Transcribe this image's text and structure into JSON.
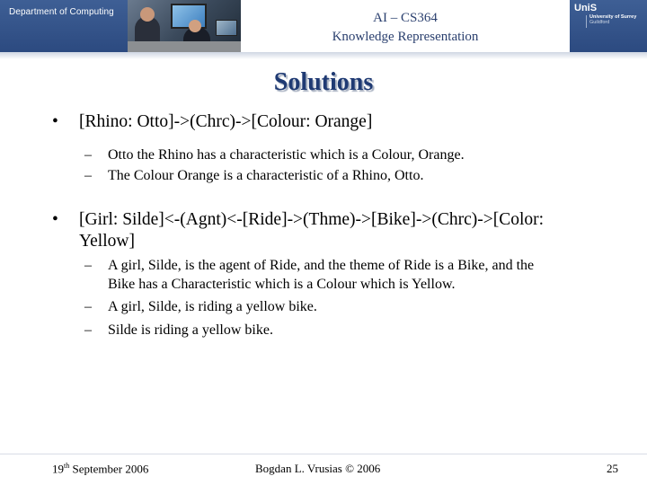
{
  "header": {
    "department": "Department of Computing",
    "course_title": "AI – CS364",
    "course_subtitle": "Knowledge Representation",
    "logo_text": "UniS",
    "university_line1": "University of Surrey",
    "university_line2": "Guildford"
  },
  "slide": {
    "title": "Solutions",
    "bullets": [
      {
        "lines": [
          "[Rhino: Otto]->(Chrc)->[Colour: Orange]"
        ],
        "subitems": [
          [
            "Otto the Rhino has a characteristic which is a Colour, Orange."
          ],
          [
            "The Colour Orange is a characteristic of a Rhino, Otto."
          ]
        ]
      },
      {
        "lines": [
          "[Girl: Silde]<-(Agnt)<-[Ride]->(Thme)->[Bike]->(Chrc)->[Color:",
          "Yellow]"
        ],
        "subitems": [
          [
            "A girl, Silde, is the agent of Ride, and the theme of Ride is a Bike, and the",
            "Bike has a Characteristic which is a Colour which is Yellow."
          ],
          [
            "A girl, Silde, is riding a yellow bike."
          ],
          [
            "Silde is riding a yellow bike."
          ]
        ]
      }
    ]
  },
  "footer": {
    "date_day": "19",
    "date_suffix": "th",
    "date_rest": " September 2006",
    "author": "Bogdan L. Vrusias © 2006",
    "page_number": "25"
  },
  "colors": {
    "header_blue": "#2c4a80",
    "title_blue": "#1f3a73",
    "course_text": "#2a3f6e"
  }
}
